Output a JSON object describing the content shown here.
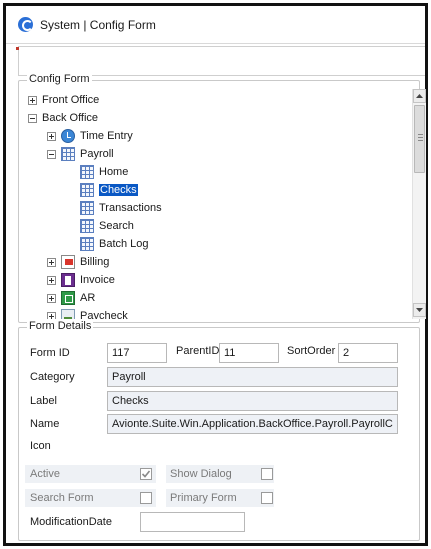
{
  "window": {
    "title": "System | Config Form"
  },
  "config_form": {
    "legend": "Config Form",
    "tree": [
      {
        "label": "Front Office",
        "expander": "plus",
        "icon": "none",
        "selected": false
      },
      {
        "label": "Back Office",
        "expander": "minus",
        "icon": "none",
        "selected": false
      },
      {
        "label": "Time Entry",
        "expander": "plus",
        "icon": "clock-icon",
        "selected": false
      },
      {
        "label": "Payroll",
        "expander": "minus",
        "icon": "grid-icon",
        "selected": false
      },
      {
        "label": "Home",
        "expander": "none",
        "icon": "grid-icon",
        "selected": false
      },
      {
        "label": "Checks",
        "expander": "none",
        "icon": "grid-icon",
        "selected": true
      },
      {
        "label": "Transactions",
        "expander": "none",
        "icon": "grid-icon",
        "selected": false
      },
      {
        "label": "Search",
        "expander": "none",
        "icon": "grid-icon",
        "selected": false
      },
      {
        "label": "Batch Log",
        "expander": "none",
        "icon": "grid-icon",
        "selected": false
      },
      {
        "label": "Billing",
        "expander": "plus",
        "icon": "billing-icon",
        "selected": false
      },
      {
        "label": "Invoice",
        "expander": "plus",
        "icon": "invoice-icon",
        "selected": false
      },
      {
        "label": "AR",
        "expander": "plus",
        "icon": "ar-icon",
        "selected": false
      },
      {
        "label": "Paycheck",
        "expander": "plus",
        "icon": "paycheck-icon",
        "selected": false
      }
    ]
  },
  "form_details": {
    "legend": "Form Details",
    "form_id_label": "Form ID",
    "form_id": "117",
    "parent_id_label": "ParentID",
    "parent_id": "11",
    "sort_order_label": "SortOrder",
    "sort_order": "2",
    "category_label": "Category",
    "category": "Payroll",
    "label_label": "Label",
    "label": "Checks",
    "name_label": "Name",
    "name": "Avionte.Suite.Win.Application.BackOffice.Payroll.PayrollC",
    "icon_label": "Icon",
    "active_label": "Active",
    "active": true,
    "show_dialog_label": "Show Dialog",
    "show_dialog": false,
    "search_form_label": "Search Form",
    "search_form": false,
    "primary_form_label": "Primary Form",
    "primary_form": false,
    "modification_date_label": "ModificationDate",
    "modification_date": ""
  }
}
